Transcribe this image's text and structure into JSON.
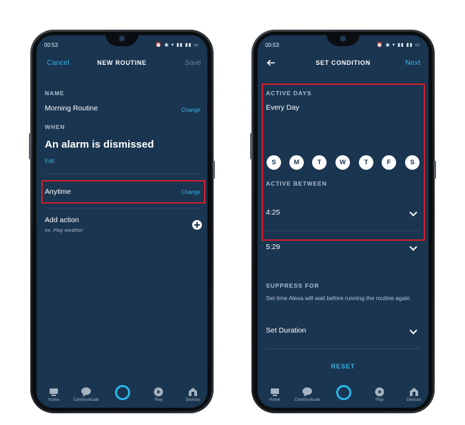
{
  "left": {
    "status_time": "00:53",
    "nav": {
      "cancel": "Cancel",
      "title": "NEW ROUTINE",
      "save": "Save"
    },
    "name_label": "NAME",
    "routine_name": "Morning Routine",
    "change_name": "Change",
    "when_label": "WHEN",
    "when_value": "An alarm is dismissed",
    "edit": "Edit",
    "anytime": "Anytime",
    "change_time": "Change",
    "add_action": "Add action",
    "add_action_hint": "ex. Play weather"
  },
  "right": {
    "status_time": "00:53",
    "nav": {
      "title": "SET CONDITION",
      "next": "Next"
    },
    "active_days_label": "ACTIVE DAYS",
    "active_days_value": "Every Day",
    "days": [
      "S",
      "M",
      "T",
      "W",
      "T",
      "F",
      "S"
    ],
    "active_between_label": "ACTIVE BETWEEN",
    "start_time": "4:25",
    "end_time": "5:29",
    "suppress_label": "SUPPRESS FOR",
    "suppress_desc": "Set time Alexa will wait before running the routine again",
    "set_duration": "Set Duration",
    "reset": "RESET"
  },
  "tabs": [
    "Home",
    "Communicate",
    "Play",
    "Devices"
  ],
  "colors": {
    "screen_bg": "#1a3550",
    "accent": "#35b4e8",
    "highlight": "#d1202f",
    "alexa_ring": "#27b6ea"
  }
}
